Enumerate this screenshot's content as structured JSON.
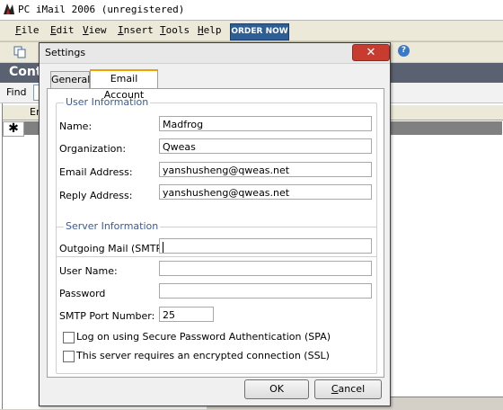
{
  "app": {
    "title": "PC iMail 2006 (unregistered)",
    "menu": [
      "File",
      "Edit",
      "View",
      "Insert",
      "Tools",
      "Help"
    ],
    "menu_underline": [
      "F",
      "E",
      "V",
      "I",
      "T",
      "H"
    ],
    "menu_rest": [
      "ile",
      "dit",
      "iew",
      "nsert",
      "ools",
      "elp"
    ],
    "order_label": "ORDER NOW",
    "help_label": "?",
    "section_header": "Cont",
    "find_label": "Find",
    "grid_header": "Em",
    "new_row_marker": "✱"
  },
  "dialog": {
    "title": "Settings",
    "close_label": "✕",
    "tabs": {
      "general": "General",
      "email": "Email Account"
    },
    "user_group_title": "User Information",
    "server_group_title": "Server Information",
    "fields": {
      "name_label": "Name:",
      "name_value": "Madfrog",
      "org_label": "Organization:",
      "org_value": "Qweas",
      "email_label": "Email Address:",
      "email_value": "yanshusheng@qweas.net",
      "reply_label": "Reply Address:",
      "reply_value": "yanshusheng@qweas.net",
      "smtp_label": "Outgoing Mail (SMTP)",
      "smtp_value": "",
      "username_label": "User Name:",
      "username_value": "",
      "password_label": "Password",
      "password_value": "",
      "port_label": "SMTP Port Number:",
      "port_value": "25"
    },
    "checkboxes": {
      "spa_label": "Log on using Secure Password Authentication (SPA)",
      "ssl_label": "This server requires an encrypted connection (SSL)"
    },
    "buttons": {
      "ok_label": "OK",
      "cancel_underline": "C",
      "cancel_rest": "ancel"
    }
  }
}
